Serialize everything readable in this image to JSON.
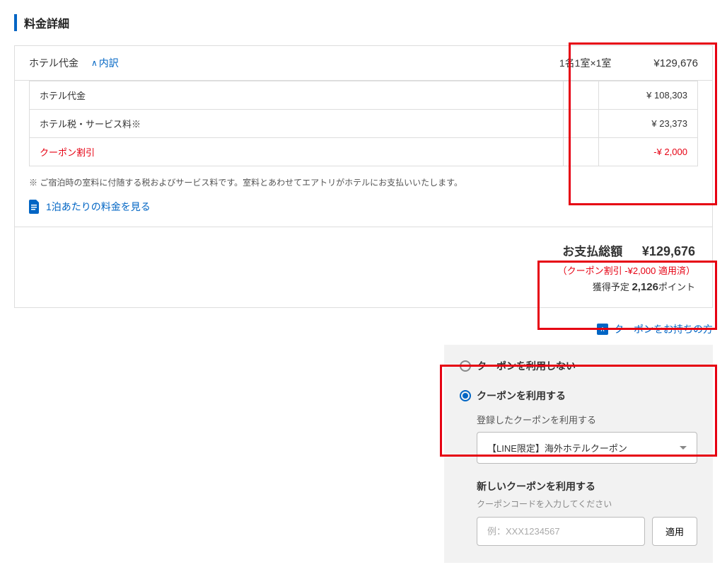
{
  "title": "料金詳細",
  "header": {
    "label": "ホテル代金",
    "toggle": "内訳",
    "room_spec": "1名1室×1室",
    "total": "¥129,676"
  },
  "breakdown": [
    {
      "label": "ホテル代金",
      "value": "¥ 108,303",
      "discount": false
    },
    {
      "label": "ホテル税・サービス料※",
      "value": "¥ 23,373",
      "discount": false
    },
    {
      "label": "クーポン割引",
      "value": "-¥ 2,000",
      "discount": true
    }
  ],
  "footnote": "※ ご宿泊時の室料に付随する税およびサービス料です。室料とあわせてエアトリがホテルにお支払いいたします。",
  "per_night_link": "1泊あたりの料金を見る",
  "total": {
    "label": "お支払総額",
    "amount": "¥129,676",
    "applied": "（クーポン割引 -¥2,000 適用済）",
    "points_prefix": "獲得予定 ",
    "points_value": "2,126",
    "points_suffix": "ポイント"
  },
  "coupon_holder_link": "クーポンをお持ちの方",
  "coupon": {
    "opt_no": "クーポンを利用しない",
    "opt_yes": "クーポンを利用する",
    "registered_label": "登録したクーポンを利用する",
    "dropdown_value": "【LINE限定】海外ホテルクーポン",
    "new_label": "新しいクーポンを利用する",
    "new_helper": "クーポンコードを入力してください",
    "placeholder": "例：XXX1234567",
    "apply": "適用"
  }
}
